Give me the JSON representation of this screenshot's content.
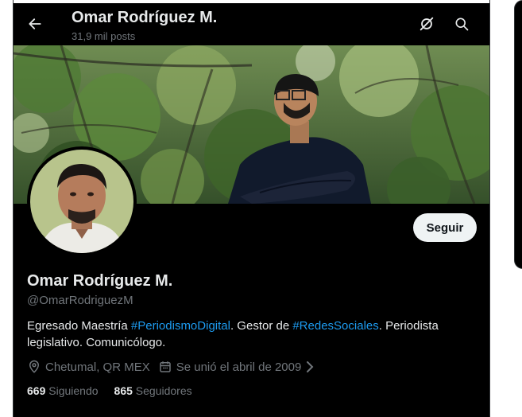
{
  "header": {
    "title": "Omar Rodríguez M.",
    "posts_count": "31,9 mil posts",
    "back_icon": "arrow-left-icon",
    "translate_icon": "no-translate-icon",
    "search_icon": "search-icon"
  },
  "profile": {
    "name": "Omar Rodríguez M.",
    "handle": "@OmarRodriguezM",
    "follow_label": "Seguir",
    "bio": {
      "part1": "Egresado Maestría ",
      "hashtag1": "#PeriodismoDigital",
      "part2": ". Gestor de ",
      "hashtag2": "#RedesSociales",
      "part3": ". Periodista legislativo. Comunicólogo."
    },
    "location": "Chetumal, QR MEX",
    "joined": "Se unió el abril de 2009"
  },
  "stats": {
    "following_count": "669",
    "following_label": "Siguiendo",
    "followers_count": "865",
    "followers_label": "Seguidores"
  },
  "colors": {
    "background": "#000000",
    "accent": "#1d9bf0",
    "secondary_text": "#71767b",
    "primary_text": "#e7e9ea"
  }
}
